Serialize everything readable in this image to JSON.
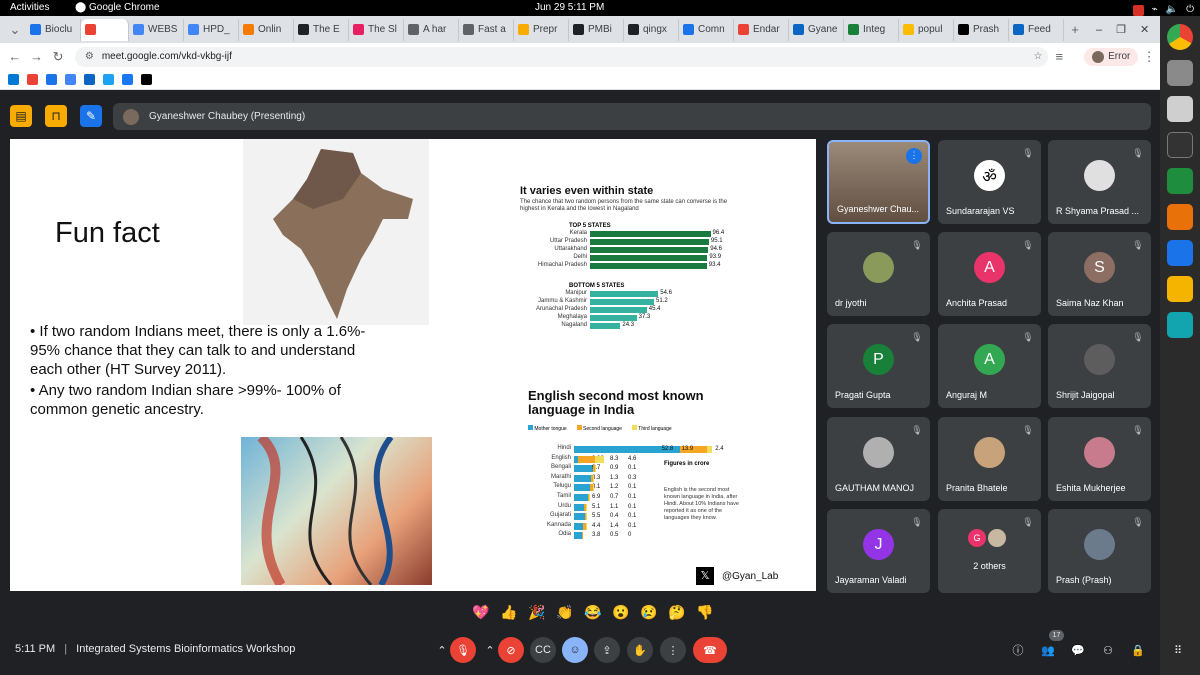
{
  "gnome": {
    "activities": "Activities",
    "app": "Google Chrome",
    "clock": "Jun 29  5:11 PM"
  },
  "tabs": [
    {
      "label": "Bioclu",
      "color": "#1a73e8"
    },
    {
      "label": "",
      "color": "#ea4335"
    },
    {
      "label": "WEBS",
      "color": "#4285f4"
    },
    {
      "label": "HPD_",
      "color": "#4285f4"
    },
    {
      "label": "Onlin",
      "color": "#f57c00"
    },
    {
      "label": "The E",
      "color": "#202124"
    },
    {
      "label": "The Sl",
      "color": "#e91e63"
    },
    {
      "label": "A har",
      "color": "#5f6368"
    },
    {
      "label": "Fast a",
      "color": "#5f6368"
    },
    {
      "label": "Prepr",
      "color": "#f9ab00"
    },
    {
      "label": "PMBi",
      "color": "#202124"
    },
    {
      "label": "qingx",
      "color": "#202124"
    },
    {
      "label": "Comn",
      "color": "#1a73e8"
    },
    {
      "label": "Endar",
      "color": "#ea4335"
    },
    {
      "label": "Gyane",
      "color": "#0a66c2"
    },
    {
      "label": "Integ",
      "color": "#188038"
    },
    {
      "label": "popul",
      "color": "#fbbc04"
    },
    {
      "label": "Prash",
      "color": "#000000"
    },
    {
      "label": "Feed",
      "color": "#0a66c2"
    }
  ],
  "new_tab": "+",
  "url": "meet.google.com/vkd-vkbg-ijf",
  "error_label": "Error",
  "meet": {
    "presenter": "Gyaneshwer Chaubey (Presenting)",
    "slide": {
      "title": "Fun fact",
      "bullet1": "If two random Indians meet, there is only a 1.6%- 95% chance that they can talk to and understand each other (HT Survey 2011).",
      "bullet2": "Any two random Indian share >99%- 100% of common genetic ancestry.",
      "handle": "@Gyan_Lab",
      "chart1": {
        "title": "It varies even within state",
        "subtitle": "The chance that two random persons from the same state can converse is the highest in Kerala and the lowest in Nagaland",
        "top_head": "TOP 5 STATES",
        "bottom_head": "BOTTOM 5 STATES"
      },
      "chart2": {
        "title": "English second most known language in India",
        "legend": [
          "Mother tongue",
          "Second language",
          "Third language"
        ],
        "note_head": "Figures in crore",
        "note": "English is the second most known language in India, after Hindi. About 10% Indians have reported it as one of the languages they know."
      }
    },
    "tiles": [
      {
        "name": "Gyaneshwer Chau...",
        "initial": "",
        "color": "#6d5c4d"
      },
      {
        "name": "Sundararajan VS",
        "initial": "ॐ",
        "color": "#ffffff"
      },
      {
        "name": "R Shyama Prasad ...",
        "initial": "",
        "color": "#e0e0e0"
      },
      {
        "name": "dr jyothi",
        "initial": "",
        "color": "#8a9a5b"
      },
      {
        "name": "Anchita Prasad",
        "initial": "A",
        "color": "#e8336b"
      },
      {
        "name": "Saima Naz Khan",
        "initial": "S",
        "color": "#8d6e63"
      },
      {
        "name": "Pragati Gupta",
        "initial": "P",
        "color": "#188038"
      },
      {
        "name": "Anguraj M",
        "initial": "A",
        "color": "#33a852"
      },
      {
        "name": "Shrijit Jaigopal",
        "initial": "",
        "color": "#5d5d5d"
      },
      {
        "name": "GAUTHAM MANOJ",
        "initial": "",
        "color": "#b0b0b0"
      },
      {
        "name": "Pranita Bhatele",
        "initial": "",
        "color": "#c8a27a"
      },
      {
        "name": "Eshita Mukherjee",
        "initial": "",
        "color": "#c77b8d"
      },
      {
        "name": "Jayaraman Valadi",
        "initial": "J",
        "color": "#9334e6"
      },
      {
        "name": "2 others",
        "initial": "G",
        "color": "#e8336b"
      },
      {
        "name": "Prash (Prash)",
        "initial": "",
        "color": "#6b7b8c"
      }
    ],
    "reactions": [
      "💖",
      "👍",
      "🎉",
      "👏",
      "😂",
      "😮",
      "😢",
      "🤔",
      "👎"
    ],
    "bottom": {
      "time": "5:11 PM",
      "title": "Integrated Systems Bioinformatics Workshop",
      "people_count": "17"
    }
  },
  "chart_data": [
    {
      "type": "bar",
      "title": "It varies even within state",
      "series": [
        {
          "name": "TOP 5 STATES",
          "categories": [
            "Kerala",
            "Uttar Pradesh",
            "Uttarakhand",
            "Delhi",
            "Himachal Pradesh"
          ],
          "values": [
            96.4,
            95.1,
            94.6,
            93.9,
            93.4
          ],
          "color": "#1b7a3f"
        },
        {
          "name": "BOTTOM 5 STATES",
          "categories": [
            "Manipur",
            "Jammu & Kashmir",
            "Arunachal Pradesh",
            "Meghalaya",
            "Nagaland"
          ],
          "values": [
            54.6,
            51.2,
            45.4,
            37.3,
            24.3
          ],
          "color": "#36b3a0"
        }
      ],
      "ylim": [
        0,
        100
      ]
    },
    {
      "type": "bar",
      "title": "English second most known language in India",
      "categories": [
        "Hindi",
        "English",
        "Bengali",
        "Marathi",
        "Telugu",
        "Tamil",
        "Urdu",
        "Gujarati",
        "Kannada",
        "Odia"
      ],
      "series": [
        {
          "name": "Mother tongue",
          "values": [
            52.8,
            0.02,
            9.7,
            8.3,
            8.1,
            6.9,
            5.1,
            5.5,
            4.4,
            3.8
          ],
          "color": "#29a3d1"
        },
        {
          "name": "Second language",
          "values": [
            13.9,
            8.3,
            0.9,
            1.3,
            1.2,
            0.7,
            1.1,
            0.4,
            1.4,
            0.5
          ],
          "color": "#f5a623"
        },
        {
          "name": "Third language",
          "values": [
            2.4,
            4.6,
            0.1,
            0.3,
            0.1,
            0.1,
            0.1,
            0.1,
            0.1,
            0
          ],
          "color": "#f2dd5a"
        }
      ],
      "annotation": "Figures in crore"
    }
  ]
}
